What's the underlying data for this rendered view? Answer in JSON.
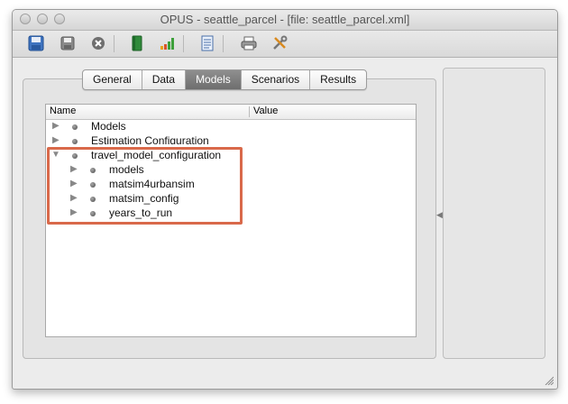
{
  "window": {
    "title": "OPUS - seattle_parcel - [file: seattle_parcel.xml]"
  },
  "toolbar": {
    "icons": [
      "save-blue-icon",
      "save-icon",
      "close-circle-icon",
      "book-icon",
      "bar-chart-icon",
      "document-icon",
      "print-icon",
      "tools-icon"
    ]
  },
  "tabs": [
    {
      "label": "General"
    },
    {
      "label": "Data"
    },
    {
      "label": "Models",
      "active": true
    },
    {
      "label": "Scenarios"
    },
    {
      "label": "Results"
    }
  ],
  "tree": {
    "columns": {
      "name": "Name",
      "value": "Value"
    },
    "rows": [
      {
        "label": "Models",
        "expanded": false,
        "depth": 0
      },
      {
        "label": "Estimation Configuration",
        "expanded": false,
        "depth": 0
      },
      {
        "label": "travel_model_configuration",
        "expanded": true,
        "depth": 0
      },
      {
        "label": "models",
        "expanded": false,
        "depth": 1
      },
      {
        "label": "matsim4urbansim",
        "expanded": false,
        "depth": 1
      },
      {
        "label": "matsim_config",
        "expanded": false,
        "depth": 1
      },
      {
        "label": "years_to_run",
        "expanded": false,
        "depth": 1
      }
    ]
  },
  "colors": {
    "highlight": "#d9694a",
    "active_tab": "#7d7d7d"
  }
}
